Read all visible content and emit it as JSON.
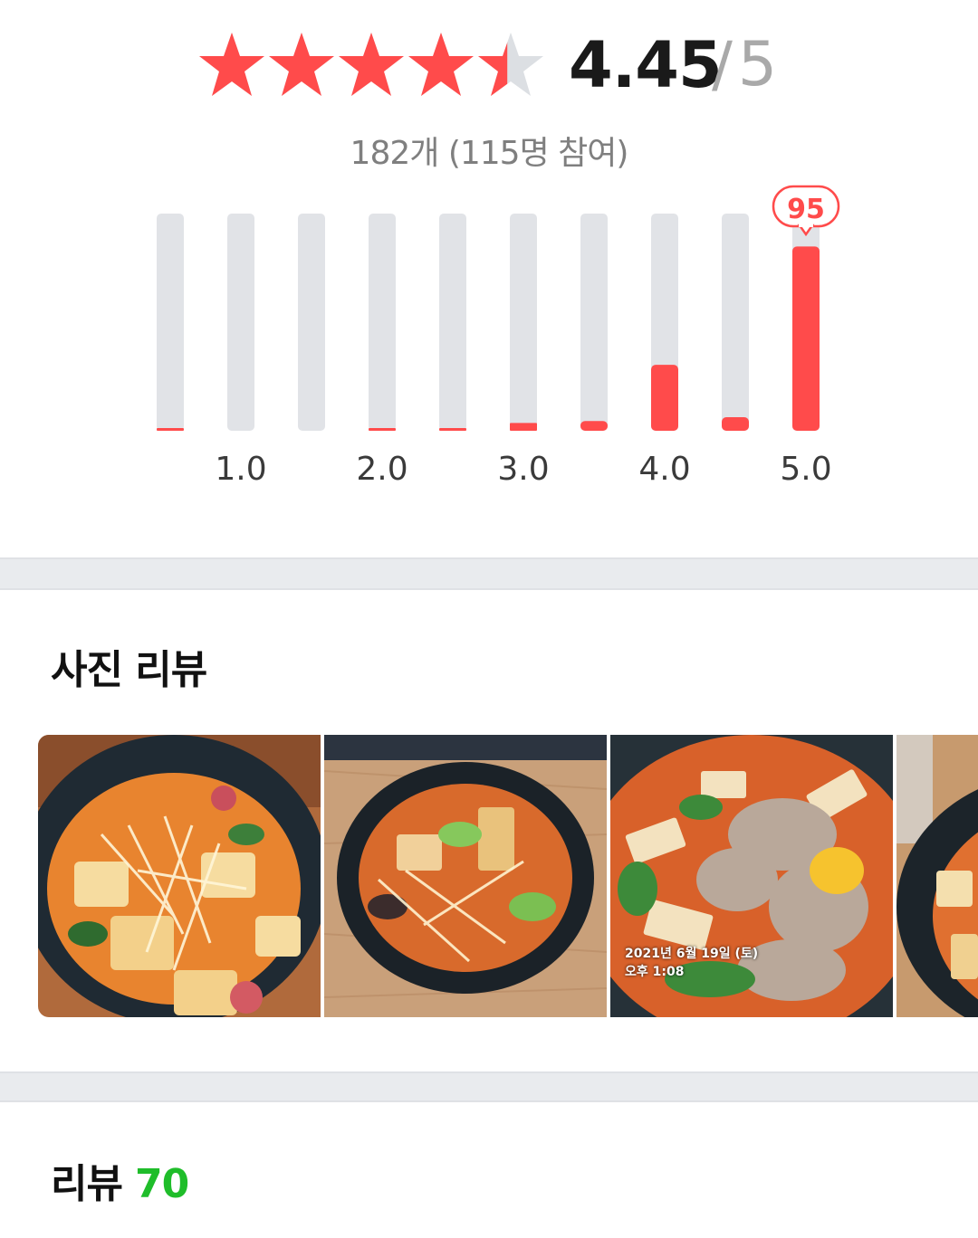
{
  "rating": {
    "score": "4.45",
    "out_of": "5",
    "stars_filled_fraction": 0.89,
    "summary": "182개 (115명 참여)"
  },
  "colors": {
    "accent_red": "#ff4b4b",
    "track_gray": "#e1e3e7",
    "count_green": "#1fbd2a"
  },
  "chart_data": {
    "type": "bar",
    "categories": [
      "0.5",
      "1.0",
      "1.5",
      "2.0",
      "2.5",
      "3.0",
      "3.5",
      "4.0",
      "4.5",
      "5.0"
    ],
    "tick_labels": [
      "1.0",
      "2.0",
      "3.0",
      "4.0",
      "5.0"
    ],
    "values": [
      1,
      0,
      0,
      1,
      1,
      4,
      5,
      34,
      7,
      95
    ],
    "max_value": 95,
    "highlight_label": "95",
    "ylim": [
      0,
      112
    ],
    "grid": false
  },
  "photo_section": {
    "title": "사진 리뷰",
    "photos": [
      {
        "icon": "food-photo-1"
      },
      {
        "icon": "food-photo-2"
      },
      {
        "icon": "food-photo-3",
        "date_line1": "2021년 6월 19일 (토)",
        "date_line2": "오후 1:08"
      },
      {
        "icon": "food-photo-4"
      }
    ]
  },
  "review_section": {
    "title": "리뷰",
    "count": "70"
  }
}
